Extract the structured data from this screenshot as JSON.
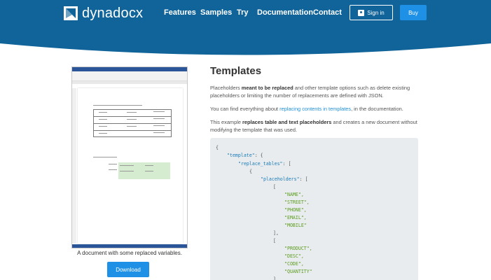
{
  "header": {
    "logo_text": "dynadocx",
    "nav": [
      "Features",
      "Samples",
      "Try",
      "Documentation",
      "Contact"
    ],
    "signin_label": "Sign in",
    "buy_label": "Buy",
    "colors": {
      "primary": "#10649a",
      "accent": "#1e90e6"
    }
  },
  "preview": {
    "caption": "A document with some replaced variables.",
    "download_label": "Download"
  },
  "main": {
    "title": "Templates",
    "p1_pre": "Placeholders ",
    "p1_bold": "meant to be replaced",
    "p1_post": " and other template options such as delete existing placeholders or limiting the number of replacements are defined with JSON.",
    "p2_pre": "You can find everything about ",
    "p2_link": "replacing contents in templates",
    "p2_post": ", in the documentation.",
    "p3_pre": "This example ",
    "p3_bold": "replaces table and text placeholders",
    "p3_post": " and creates a new document without modifying the template that was used."
  },
  "code": {
    "l1": "{",
    "l2_key": "\"template\"",
    "l2_post": ": {",
    "l3_key": "\"replace_tables\"",
    "l3_post": ": [",
    "l4": "{",
    "l5_key": "\"placeholders\"",
    "l5_post": ": [",
    "l6": "[",
    "l7": "\"NAME\",",
    "l8": "\"STREET\",",
    "l9": "\"PHONE\",",
    "l10": "\"EMAIL\",",
    "l11": "\"MOBILE\"",
    "l12": "],",
    "l13": "[",
    "l14": "\"PRODUCT\",",
    "l15": "\"DESC\",",
    "l16": "\"CODE\",",
    "l17": "\"QUANTITY\"",
    "l18": "]"
  }
}
